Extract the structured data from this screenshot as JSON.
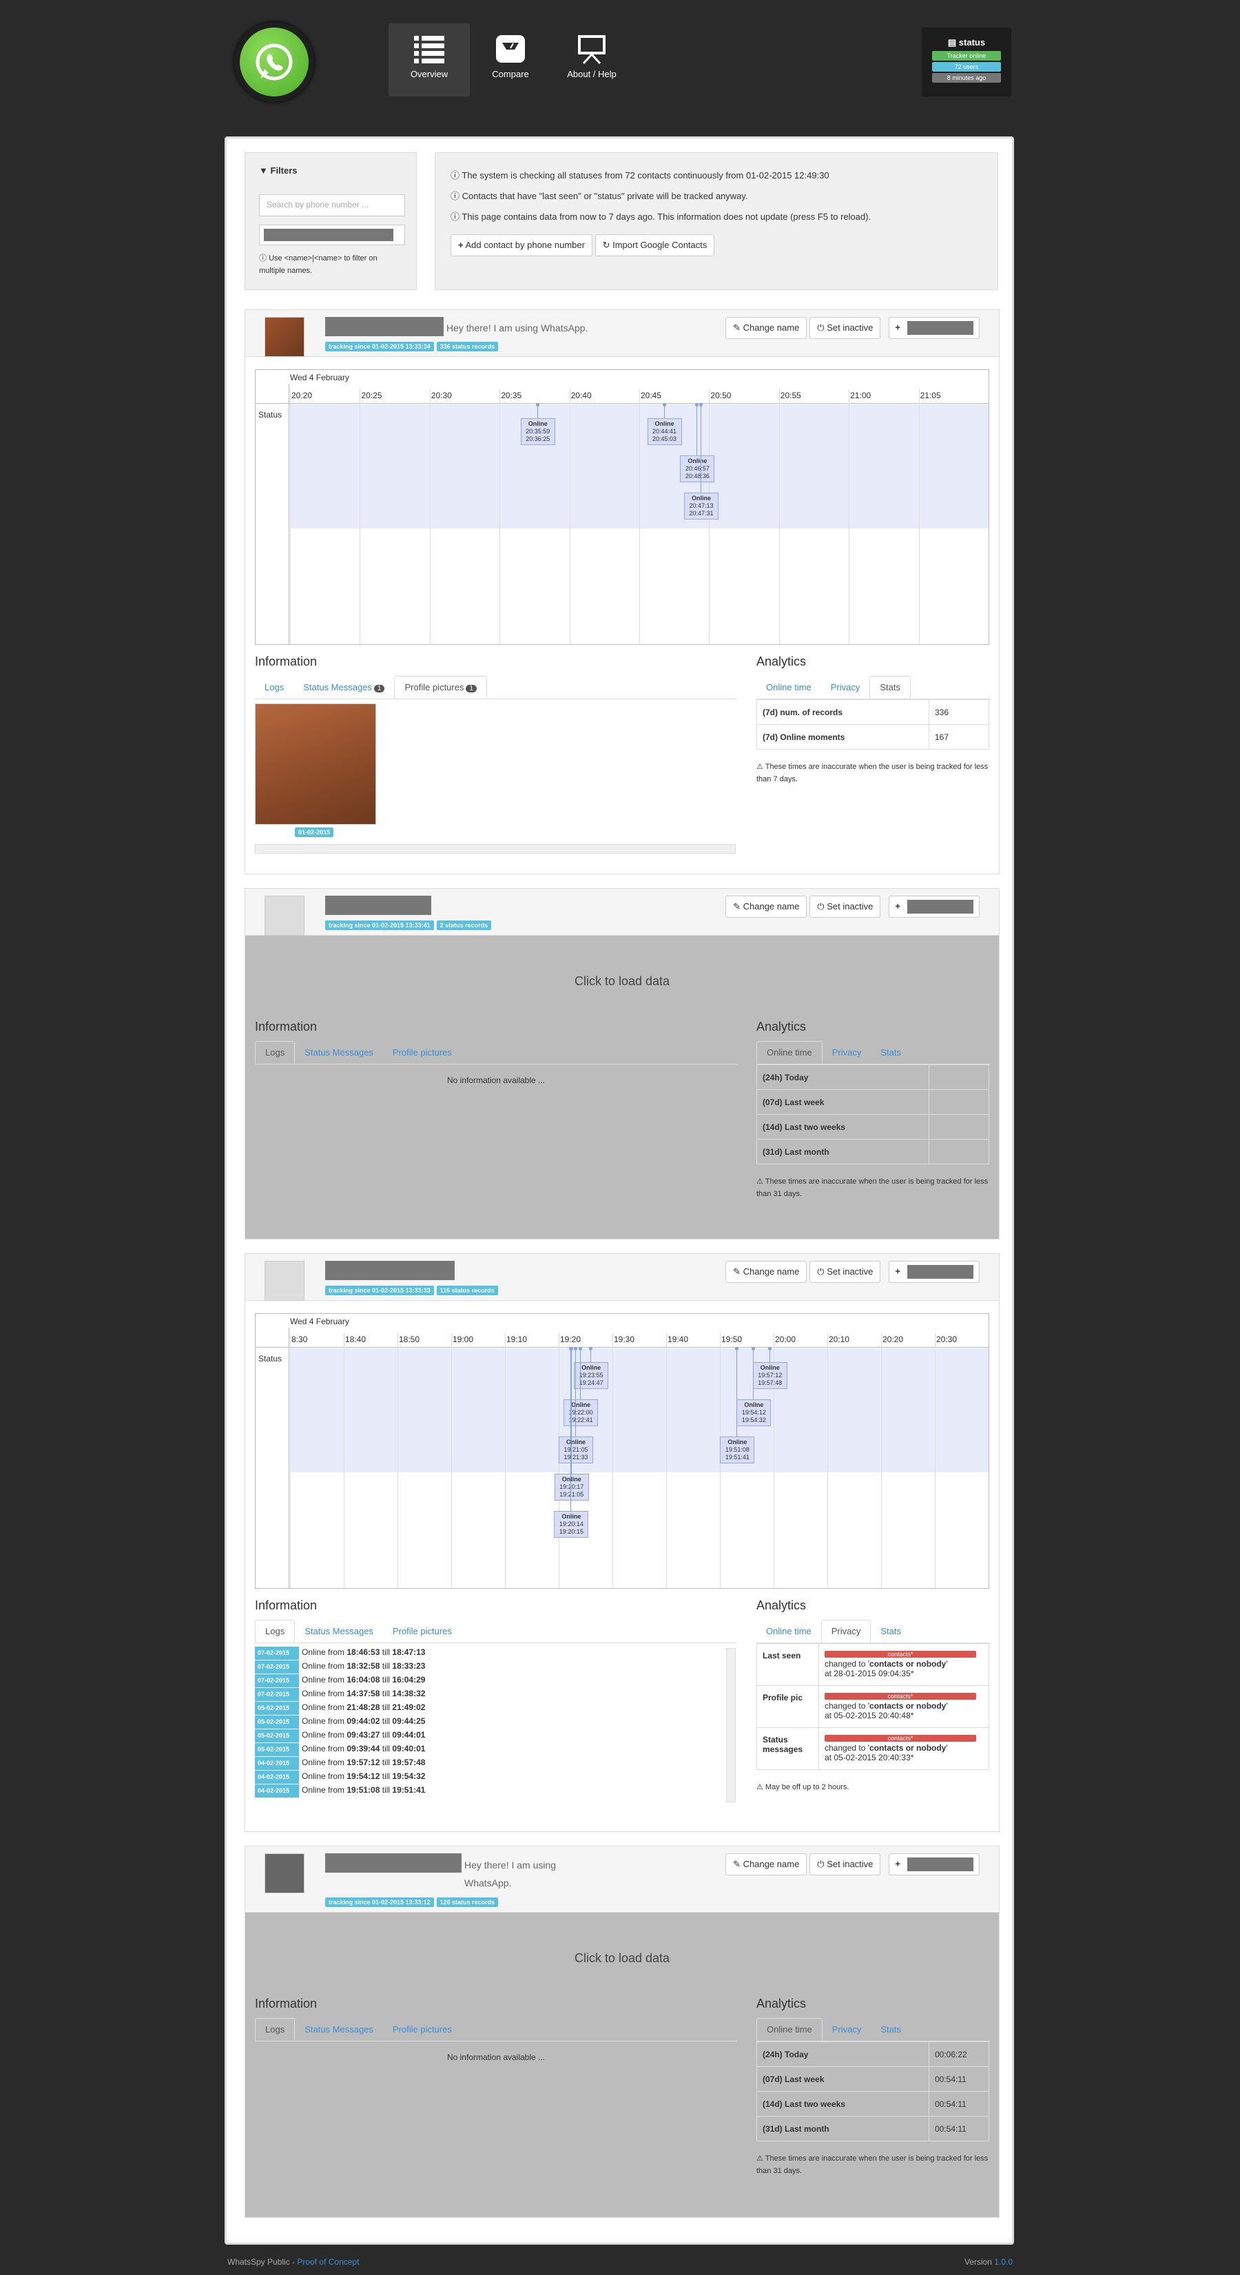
{
  "nav": {
    "items": [
      {
        "label": "Overview",
        "icon": "list-icon",
        "active": true
      },
      {
        "label": "Compare",
        "icon": "scale-icon",
        "active": false
      },
      {
        "label": "About / Help",
        "icon": "presentation-icon",
        "active": false
      }
    ]
  },
  "status": {
    "title": "status",
    "tracker": "Tracker online",
    "users": "72 users",
    "updated": "8 minutes ago",
    "colors": {
      "tracker": "#5cb85c",
      "users": "#5bc0de",
      "updated": "#777777"
    }
  },
  "filters": {
    "title": "Filters",
    "search_placeholder": "Search by phone number ...",
    "help": "Use <name>|<name> to filter on multiple names."
  },
  "info": {
    "lines": [
      "The system is checking all statuses from 72 contacts continuously from 01-02-2015 12:49:30",
      "Contacts that have \"last seen\" or \"status\" private will be tracked anyway.",
      "This page contains data from now to 7 days ago. This information does not update (press F5 to reload)."
    ],
    "add_button": "Add contact by phone number",
    "import_button": "Import Google Contacts"
  },
  "common": {
    "change_name": "Change name",
    "set_inactive": "Set inactive",
    "plus": "+",
    "information": "Information",
    "analytics": "Analytics",
    "tabs_info": [
      "Logs",
      "Status Messages",
      "Profile pictures"
    ],
    "tabs_analytics": [
      "Online time",
      "Privacy",
      "Stats"
    ],
    "click_load": "Click to load data",
    "no_info": "No information available ...",
    "status_label": "Status",
    "warn_7d": "These times are inaccurate when the user is being tracked for less than 7 days.",
    "warn_31d": "These times are inaccurate when the user is being tracked for less than 31 days.",
    "warn_privacy": "May be off up to 2 hours."
  },
  "contacts": [
    {
      "status_message": "Hey there! I am using WhatsApp.",
      "tracking": "tracking since 01-02-2015 13:33:34",
      "records": "336 status records",
      "timeline": {
        "date": "Wed 4 February",
        "ticks": [
          "20:20",
          "20:25",
          "20:30",
          "20:35",
          "20:40",
          "20:45",
          "20:50",
          "20:55",
          "21:00",
          "21:05"
        ],
        "events": [
          {
            "label": "Online",
            "from": "20:35:59",
            "till": "20:36:25"
          },
          {
            "label": "Online",
            "from": "20:44:41",
            "till": "20:45:03"
          },
          {
            "label": "Online",
            "from": "20:46:57",
            "till": "20:48:36"
          },
          {
            "label": "Online",
            "from": "20:47:13",
            "till": "20:47:31"
          }
        ]
      },
      "info_badges": {
        "status_messages": "1",
        "profile_pictures": "1"
      },
      "profile_picture_date": "01-02-2015",
      "stats": [
        {
          "label": "(7d) num. of records",
          "value": "336"
        },
        {
          "label": "(7d) Online moments",
          "value": "167"
        }
      ]
    },
    {
      "tracking": "tracking since 01-02-2015 13:33:41",
      "records": "2 status records",
      "online_time": [
        {
          "label": "(24h) Today",
          "value": ""
        },
        {
          "label": "(07d) Last week",
          "value": ""
        },
        {
          "label": "(14d) Last two weeks",
          "value": ""
        },
        {
          "label": "(31d) Last month",
          "value": ""
        }
      ]
    },
    {
      "tracking": "tracking since 01-02-2015 13:33:33",
      "records": "116 status records",
      "timeline": {
        "date": "Wed 4 February",
        "ticks": [
          "8:30",
          "18:40",
          "18:50",
          "19:00",
          "19:10",
          "19:20",
          "19:30",
          "19:40",
          "19:50",
          "20:00",
          "20:10",
          "20:20",
          "20:30"
        ],
        "events": [
          {
            "label": "Online",
            "from": "19:23:55",
            "till": "19:24:47"
          },
          {
            "label": "Online",
            "from": "19:22:00",
            "till": "19:22:41"
          },
          {
            "label": "Online",
            "from": "19:21:05",
            "till": "19:21:33"
          },
          {
            "label": "Online",
            "from": "19:20:17",
            "till": "19:21:05"
          },
          {
            "label": "Online",
            "from": "19:20:14",
            "till": "19:20:15"
          },
          {
            "label": "Online",
            "from": "19:57:12",
            "till": "19:57:48"
          },
          {
            "label": "Online",
            "from": "19:54:12",
            "till": "19:54:32"
          },
          {
            "label": "Online",
            "from": "19:51:08",
            "till": "19:51:41"
          }
        ]
      },
      "logs": [
        {
          "date": "07-02-2015",
          "from": "18:46:53",
          "till": "18:47:13"
        },
        {
          "date": "07-02-2015",
          "from": "18:32:58",
          "till": "18:33:23"
        },
        {
          "date": "07-02-2015",
          "from": "16:04:08",
          "till": "16:04:29"
        },
        {
          "date": "07-02-2015",
          "from": "14:37:58",
          "till": "14:38:32"
        },
        {
          "date": "05-02-2015",
          "from": "21:48:28",
          "till": "21:49:02"
        },
        {
          "date": "05-02-2015",
          "from": "09:44:02",
          "till": "09:44:25"
        },
        {
          "date": "05-02-2015",
          "from": "09:43:27",
          "till": "09:44:01"
        },
        {
          "date": "05-02-2015",
          "from": "09:39:44",
          "till": "09:40:01"
        },
        {
          "date": "04-02-2015",
          "from": "19:57:12",
          "till": "19:57:48"
        },
        {
          "date": "04-02-2015",
          "from": "19:54:12",
          "till": "19:54:32"
        },
        {
          "date": "04-02-2015",
          "from": "19:51:08",
          "till": "19:51:41"
        }
      ],
      "privacy": [
        {
          "label": "Last seen",
          "tag": "contacts*",
          "text": "changed to",
          "value": "contacts or nobody",
          "at": "at 28-01-2015 09:04:35*"
        },
        {
          "label": "Profile pic",
          "tag": "contacts*",
          "text": "changed to",
          "value": "contacts or nobody",
          "at": "at 05-02-2015 20:40:48*"
        },
        {
          "label": "Status messages",
          "tag": "contacts*",
          "text": "changed to",
          "value": "contacts or nobody",
          "at": "at 05-02-2015 20:40:33*"
        }
      ]
    },
    {
      "status_message": "Hey there! I am using WhatsApp.",
      "tracking": "tracking since 01-02-2015 13:33:12",
      "records": "126 status records",
      "online_time": [
        {
          "label": "(24h) Today",
          "value": "00:06:22"
        },
        {
          "label": "(07d) Last week",
          "value": "00:54:11"
        },
        {
          "label": "(14d) Last two weeks",
          "value": "00:54:11"
        },
        {
          "label": "(31d) Last month",
          "value": "00:54:11"
        }
      ]
    }
  ],
  "footer": {
    "left": "WhatsSpy Public - ",
    "left_link": "Proof of Concept",
    "right": "Version ",
    "version": "1.0.0"
  }
}
